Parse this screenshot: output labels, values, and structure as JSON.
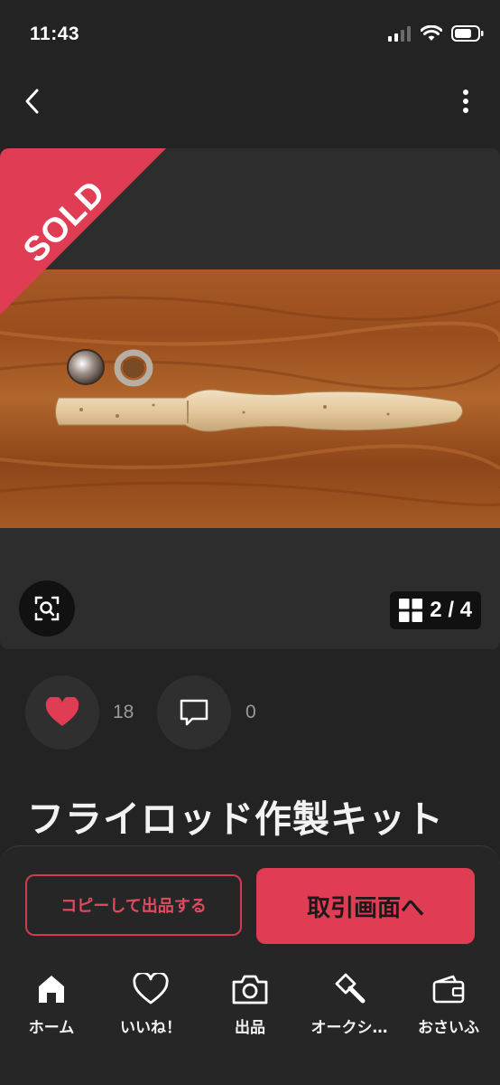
{
  "status_bar": {
    "time": "11:43"
  },
  "listing": {
    "sold_label": "SOLD",
    "image_counter": "2 / 4",
    "likes_count": "18",
    "comments_count": "0",
    "title": "フライロッド作製キット"
  },
  "bottom": {
    "copy_label": "コピーして出品する",
    "transaction_label": "取引画面へ"
  },
  "tabs": [
    {
      "label": "ホーム",
      "icon": "home-icon"
    },
    {
      "label": "いいね！",
      "icon": "heart-outline-icon"
    },
    {
      "label": "出品",
      "icon": "camera-icon"
    },
    {
      "label": "オークシ…",
      "icon": "auction-hammer-icon"
    },
    {
      "label": "おさいふ",
      "icon": "wallet-icon"
    }
  ],
  "colors": {
    "accent": "#e03c53",
    "background": "#232323"
  }
}
